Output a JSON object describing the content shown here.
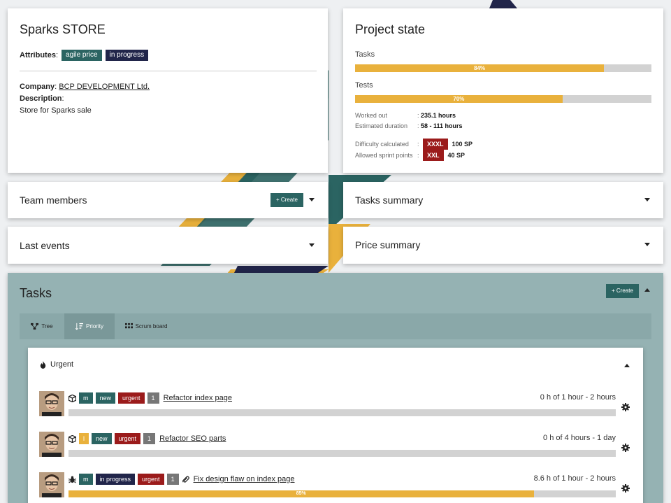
{
  "project": {
    "title": "Sparks STORE",
    "attributes_label": "Attributes",
    "attributes": [
      {
        "label": "agile price",
        "color": "#2b6462"
      },
      {
        "label": "in progress",
        "color": "#21254a"
      }
    ],
    "company_label": "Company",
    "company": "BCP DEVELOPMENT Ltd.",
    "description_label": "Description",
    "description": "Store for Sparks sale"
  },
  "state": {
    "title": "Project state",
    "tasks_label": "Tasks",
    "tasks_progress": 84,
    "tasks_progress_text": "84%",
    "tests_label": "Tests",
    "tests_progress": 70,
    "tests_progress_text": "70%",
    "worked_out_label": "Worked out",
    "worked_out": "235.1 hours",
    "estimated_label": "Estimated duration",
    "estimated": "58 - 111 hours",
    "difficulty_label": "Difficulty calculated",
    "difficulty_size": "XXXL",
    "difficulty_sp": "100 SP",
    "sprint_label": "Allowed sprint points",
    "sprint_size": "XXL",
    "sprint_sp": "40 SP",
    "colon": ":"
  },
  "panels": {
    "team_members": "Team members",
    "tasks_summary": "Tasks summary",
    "last_events": "Last events",
    "price_summary": "Price summary",
    "create_label": "Create"
  },
  "tasks_section": {
    "title": "Tasks",
    "create_label": "Create",
    "tabs": [
      {
        "label": "Tree",
        "icon": "tree-icon"
      },
      {
        "label": "Priority",
        "icon": "sort-icon"
      },
      {
        "label": "Scrum board",
        "icon": "grid-icon"
      }
    ],
    "active_tab": "Priority",
    "group_label": "Urgent",
    "tasks": [
      {
        "type_icon": "package-icon",
        "size": "m",
        "size_color": "#2b6462",
        "status": "new",
        "priority": "urgent",
        "count": "1",
        "title": "Refactor index page",
        "hours": "0 h of 1 hour - 2 hours",
        "progress": 0,
        "progress_text": ""
      },
      {
        "type_icon": "package-icon",
        "size": "l",
        "size_color": "#e9b13c",
        "status": "new",
        "priority": "urgent",
        "count": "1",
        "title": "Refactor SEO parts",
        "hours": "0 h of 4 hours - 1 day",
        "progress": 0,
        "progress_text": ""
      },
      {
        "type_icon": "bug-icon",
        "size": "m",
        "size_color": "#2b6462",
        "status": "in progress",
        "priority": "urgent",
        "count": "1",
        "attachment": true,
        "title": "Fix design flaw on index page",
        "hours": "8.6 h of 1 hour - 2 hours",
        "progress": 85,
        "progress_text": "85%"
      }
    ]
  }
}
